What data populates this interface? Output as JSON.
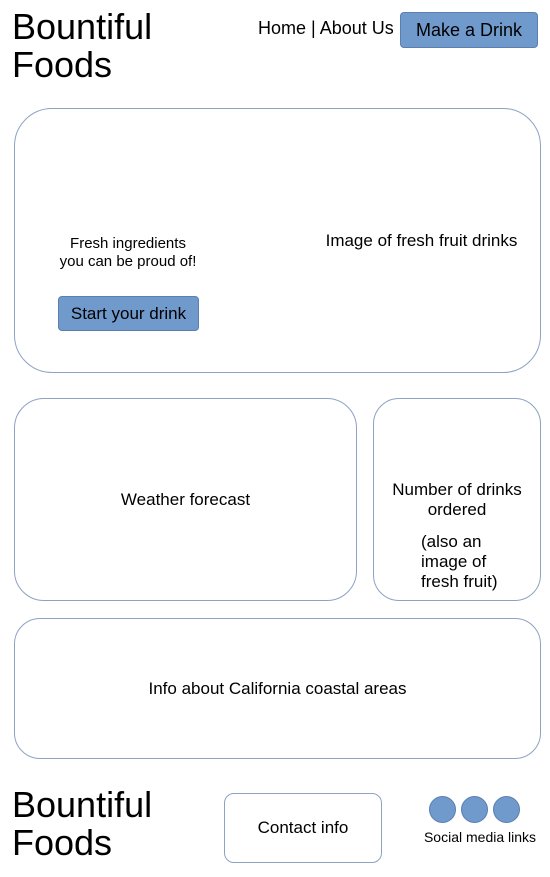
{
  "header": {
    "logo": "Bountiful\nFoods",
    "nav": {
      "home": "Home",
      "separator": " | ",
      "about": "About Us"
    },
    "cta_label": "Make a Drink"
  },
  "hero": {
    "tagline": "Fresh ingredients\nyou can be proud of!",
    "button_label": "Start your drink",
    "image_placeholder": "Image of fresh fruit drinks"
  },
  "weather": {
    "label": "Weather forecast"
  },
  "drinks_counter": {
    "label": "Number of drinks\nordered",
    "note": "(also an\nimage of\nfresh fruit)"
  },
  "info": {
    "label": "Info about California coastal areas"
  },
  "footer": {
    "logo": "Bountiful\nFoods",
    "contact_label": "Contact info",
    "social_label": "Social media links"
  },
  "colors": {
    "accent": "#7099cc",
    "border": "#8da2c4"
  }
}
